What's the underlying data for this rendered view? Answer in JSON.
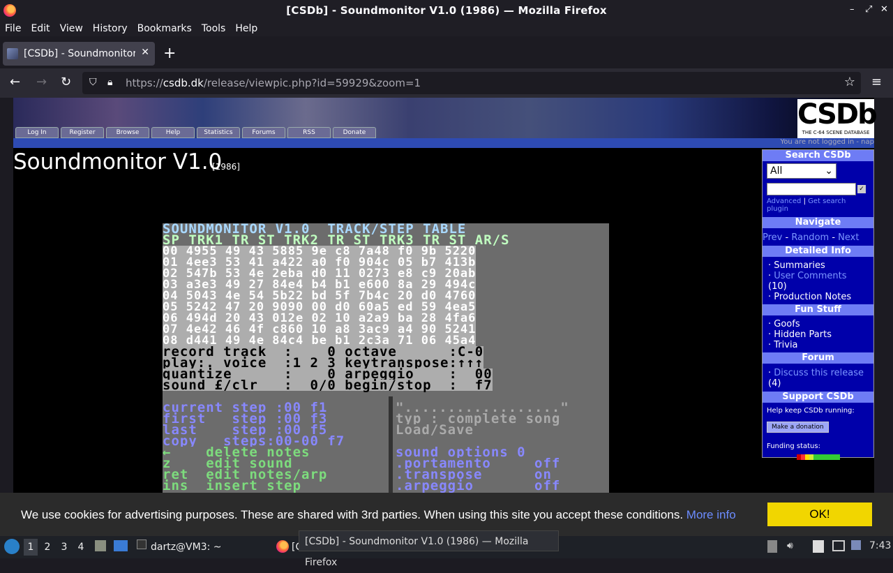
{
  "window": {
    "title": "[CSDb] - Soundmonitor V1.0 (1986) — Mozilla Firefox",
    "controls": [
      "–",
      "⤢",
      "✕"
    ]
  },
  "menubar": [
    "File",
    "Edit",
    "View",
    "History",
    "Bookmarks",
    "Tools",
    "Help"
  ],
  "tab": {
    "title": "[CSDb] - Soundmonitor V",
    "close": "✕"
  },
  "newtab": "+",
  "nav": {
    "url_host_prefix": "https://",
    "url_host": "csdb.dk",
    "url_path": "/release/viewpic.php?id=59929&zoom=1"
  },
  "site": {
    "logo_big": "CSDb",
    "logo_small": "THE C-64 SCENE DATABASE",
    "tabs": [
      "Log In",
      "Register",
      "Browse",
      "Help",
      "Statistics",
      "Forums",
      "RSS",
      "Donate"
    ],
    "login_note": "You are not logged in - nap",
    "release_title": "Soundmonitor V1.0",
    "release_year": "[1986]"
  },
  "c64": {
    "header": "SOUNDMONITOR V1.0  TRACK/STEP TABLE",
    "cols": "SP TRK1 TR ST TRK2 TR ST TRK3 TR ST AR/S",
    "rows": [
      "00 4955 49 43 5885 9e c8 7a48 f0 9b 5220",
      "01 4ee3 53 41 a422 a0 f0 904c 05 b7 413b",
      "02 547b 53 4e 2eba d0 11 0273 e8 c9 20ab",
      "03 a3e3 49 27 84e4 b4 b1 e600 8a 29 494c",
      "04 5043 4e 54 5b22 bd 5f 7b4c 20 d0 4760",
      "05 5242 47 20 9090 00 d0 60a5 ed 59 4ea5",
      "06 494d 20 43 012e 02 10 a2a9 ba 28 4fa6",
      "07 4e42 46 4f c860 10 a8 3ac9 a4 90 5241",
      "08 d441 49 4e 84c4 be b1 2c3a 71 06 45a4"
    ],
    "ctl": [
      "record track  :    0 octave      :C-0",
      "play:. voice  :1 2 3 keytranspose:↑↑↑",
      "quantize      :    0 arpeggio    :  00",
      "sound £/clr   :  0/0 begin/stop  :  f7"
    ],
    "left": [
      "current step :00 f1",
      "first   step :00 f3",
      "last    step :00 f5",
      "copy   steps:00-00 f7",
      "←    delete notes",
      "z    edit sound",
      "ret  edit notes/arp",
      "ins  insert step"
    ],
    "right": [
      "\"..................\"",
      "typ : complete song",
      "Load/Save",
      "",
      "sound options 0",
      ".portamento     off",
      ".transpose      on",
      ".arpeggio       off"
    ]
  },
  "sidebar": {
    "search_head": "Search CSDb",
    "select_value": "All",
    "search_go": "✓",
    "advanced": "Advanced",
    "sep": "|",
    "plugin": "Get search plugin",
    "navigate_head": "Navigate",
    "prev": "Prev",
    "random": "Random",
    "next": "Next",
    "dash": "-",
    "info_head": "Detailed Info",
    "summaries": "Summaries",
    "comments": "User Comments",
    "comments_count": "(10)",
    "production": "Production Notes",
    "fun_head": "Fun Stuff",
    "goofs": "Goofs",
    "hidden": "Hidden Parts",
    "trivia": "Trivia",
    "forum_head": "Forum",
    "discuss": "Discuss this release",
    "discuss_count": "(4)",
    "support_head": "Support CSDb",
    "keep": "Help keep CSDb running:",
    "donate": "Make a donation",
    "funding": "Funding status:",
    "funding_colors": [
      "#d00000",
      "#ff3333",
      "#ffdd00",
      "#ccee33",
      "#33cc33",
      "#33cc33",
      "#33cc33",
      "#33cc33",
      "#33cc33",
      "#33cc33"
    ]
  },
  "cookie": {
    "text": "We use cookies for advertising purposes. These are shared with 3rd parties. When using this site you accept these conditions.",
    "more": "More info",
    "ok": "OK!"
  },
  "taskbar": {
    "workspaces": [
      "1",
      "2",
      "3",
      "4"
    ],
    "terminal": "dartz@VM3: ~",
    "firefox_short": "[C",
    "tooltip": "[CSDb] - Soundmonitor V1.0 (1986) — Mozilla Firefox",
    "clock": "7:43"
  }
}
